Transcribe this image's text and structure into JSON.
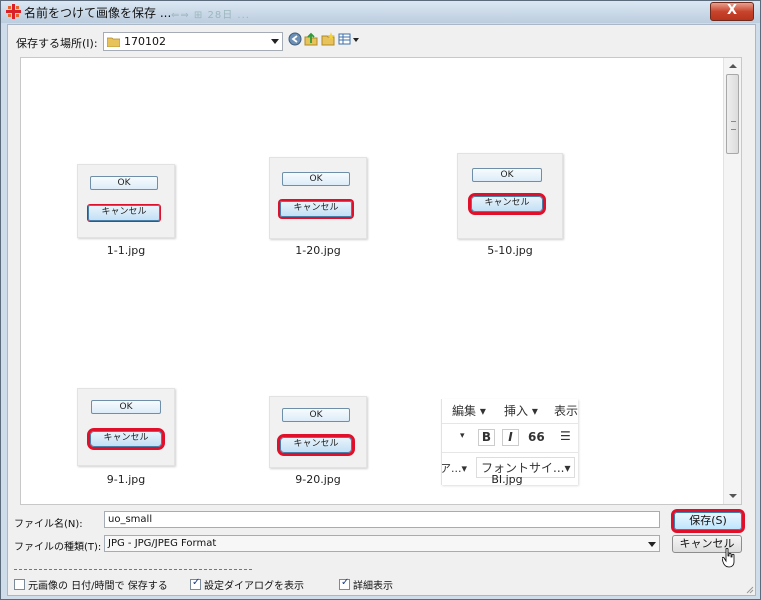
{
  "window": {
    "title": "名前をつけて画像を保存 ...",
    "background_title": "⇐⇒ ⊞ 28日 ...",
    "close_label": "X"
  },
  "toolbar": {
    "location_label": "保存する場所(I):",
    "location_value": "170102",
    "icons": [
      "back-icon",
      "up-folder-icon",
      "new-folder-icon",
      "view-menu-icon"
    ]
  },
  "files": [
    {
      "name": "1-1.jpg",
      "ok": "OK",
      "cancel": "キャンセル"
    },
    {
      "name": "1-20.jpg",
      "ok": "OK",
      "cancel": "キャンセル"
    },
    {
      "name": "5-10.jpg",
      "ok": "OK",
      "cancel": "キャンセル"
    },
    {
      "name": "9-1.jpg",
      "ok": "OK",
      "cancel": "キャンセル"
    },
    {
      "name": "9-20.jpg",
      "ok": "OK",
      "cancel": "キャンセル"
    },
    {
      "name": "BI.jpg",
      "menu1": "編集 ▾",
      "menu2": "挿入 ▾",
      "menu3": "表示",
      "bold": "B",
      "italic": "I",
      "quote": "66",
      "font_left": "ア...▾",
      "font_size": "フォントサイ...▾"
    }
  ],
  "form": {
    "filename_label": "ファイル名(N):",
    "filename_value": "uo_small",
    "filetype_label": "ファイルの種類(T):",
    "filetype_value": "JPG - JPG/JPEG Format",
    "save_label": "保存(S)",
    "cancel_label": "キャンセル"
  },
  "options": {
    "keep_date": {
      "label": "元画像の 日付/時間で 保存する",
      "checked": false
    },
    "show_settings": {
      "label": "設定ダイアログを表示",
      "checked": true
    },
    "details": {
      "label": "詳細表示",
      "checked": true
    }
  },
  "colors": {
    "highlight": "#e0102a",
    "titlebar": "#cfdcea",
    "close": "#c8442c"
  }
}
